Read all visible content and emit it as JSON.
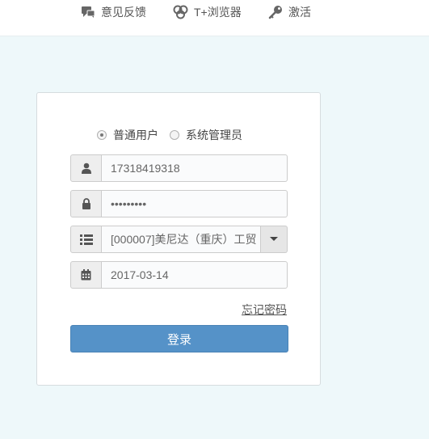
{
  "topnav": {
    "feedback": {
      "label": "意见反馈",
      "icon": "chat-icon"
    },
    "browser": {
      "label": "T+浏览器",
      "icon": "browser-icon"
    },
    "activate": {
      "label": "激活",
      "icon": "key-icon"
    }
  },
  "login": {
    "role_options": [
      {
        "label": "普通用户",
        "checked": true
      },
      {
        "label": "系统管理员",
        "checked": false
      }
    ],
    "username": {
      "value": "17318419318",
      "icon": "user-icon"
    },
    "password": {
      "value": "•••••••••",
      "icon": "lock-icon"
    },
    "account_set": {
      "value": "[000007]美尼达（重庆）工贸",
      "icon": "list-icon"
    },
    "login_date": {
      "value": "2017-03-14",
      "icon": "calendar-icon"
    },
    "forgot_password": "忘记密码",
    "submit": "登录"
  },
  "colors": {
    "page_bg": "#eef8fa",
    "primary_button": "#5592c8",
    "addon_bg": "#eeeeee"
  }
}
